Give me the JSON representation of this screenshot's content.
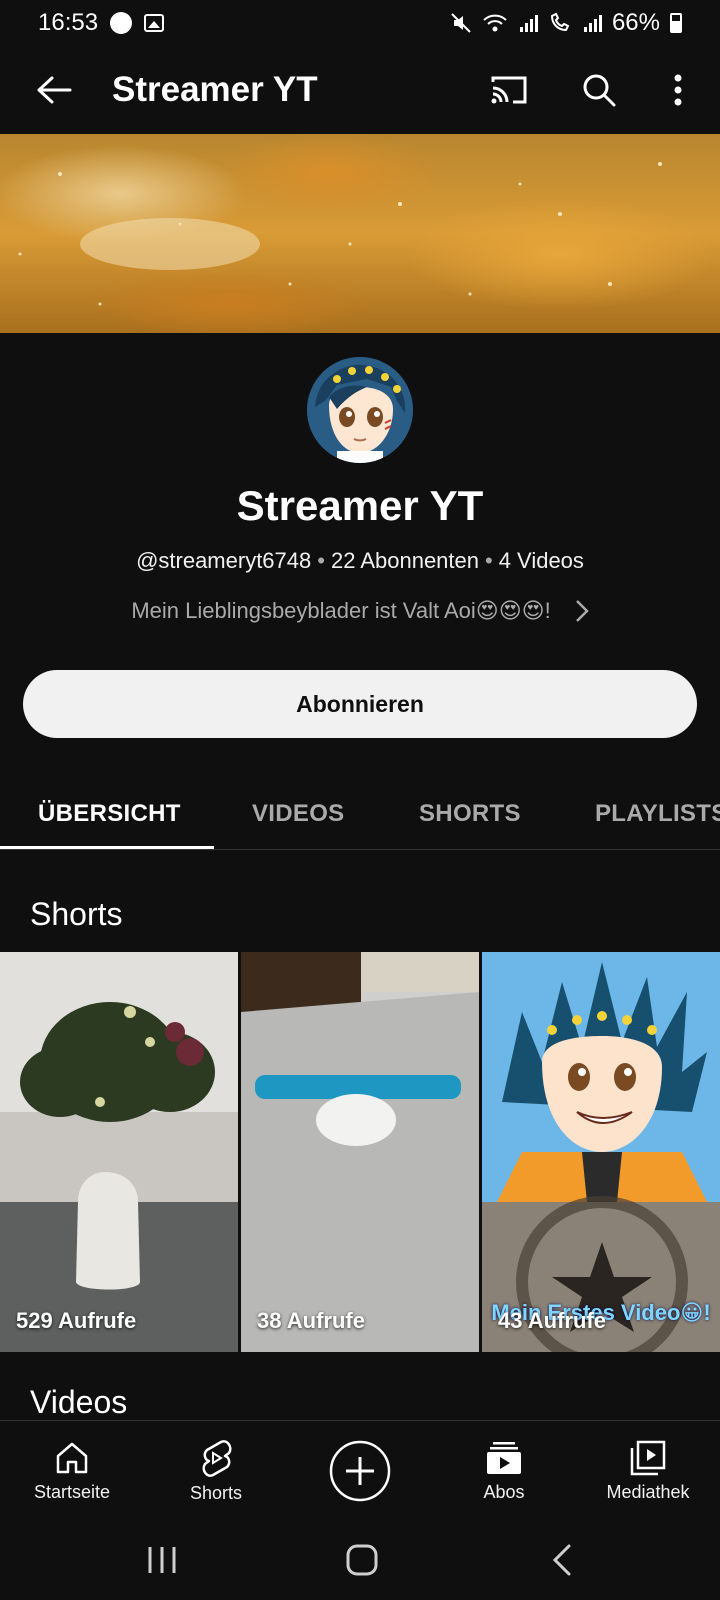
{
  "status_bar": {
    "time": "16:53",
    "battery": "66%"
  },
  "app_bar": {
    "title": "Streamer YT"
  },
  "channel": {
    "name": "Streamer YT",
    "handle": "@streameryt6748",
    "subscribers": "22 Abonnenten",
    "videos": "4 Videos",
    "description": "Mein Lieblingsbeyblader ist Valt Aoi😍😍😍!"
  },
  "subscribe_label": "Abonnieren",
  "tabs": [
    {
      "label": "ÜBERSICHT",
      "active": true
    },
    {
      "label": "VIDEOS",
      "active": false
    },
    {
      "label": "SHORTS",
      "active": false
    },
    {
      "label": "PLAYLISTS",
      "active": false
    }
  ],
  "sections": {
    "shorts_title": "Shorts",
    "videos_title": "Videos"
  },
  "shorts": [
    {
      "views": "529 Aufrufe",
      "caption": ""
    },
    {
      "views": "38 Aufrufe",
      "caption": ""
    },
    {
      "views": "43 Aufrufe",
      "caption": "Mein Erstes Video😀!"
    }
  ],
  "bottom_nav": [
    {
      "label": "Startseite",
      "icon": "home-icon"
    },
    {
      "label": "Shorts",
      "icon": "shorts-icon"
    },
    {
      "label": "",
      "icon": "create-icon"
    },
    {
      "label": "Abos",
      "icon": "subscriptions-icon"
    },
    {
      "label": "Mediathek",
      "icon": "library-icon"
    }
  ],
  "colors": {
    "background": "#0f0f0f",
    "text": "#f1f1f1",
    "secondary_text": "#aaaaaa",
    "subscribe_bg": "#f1f1f1"
  }
}
